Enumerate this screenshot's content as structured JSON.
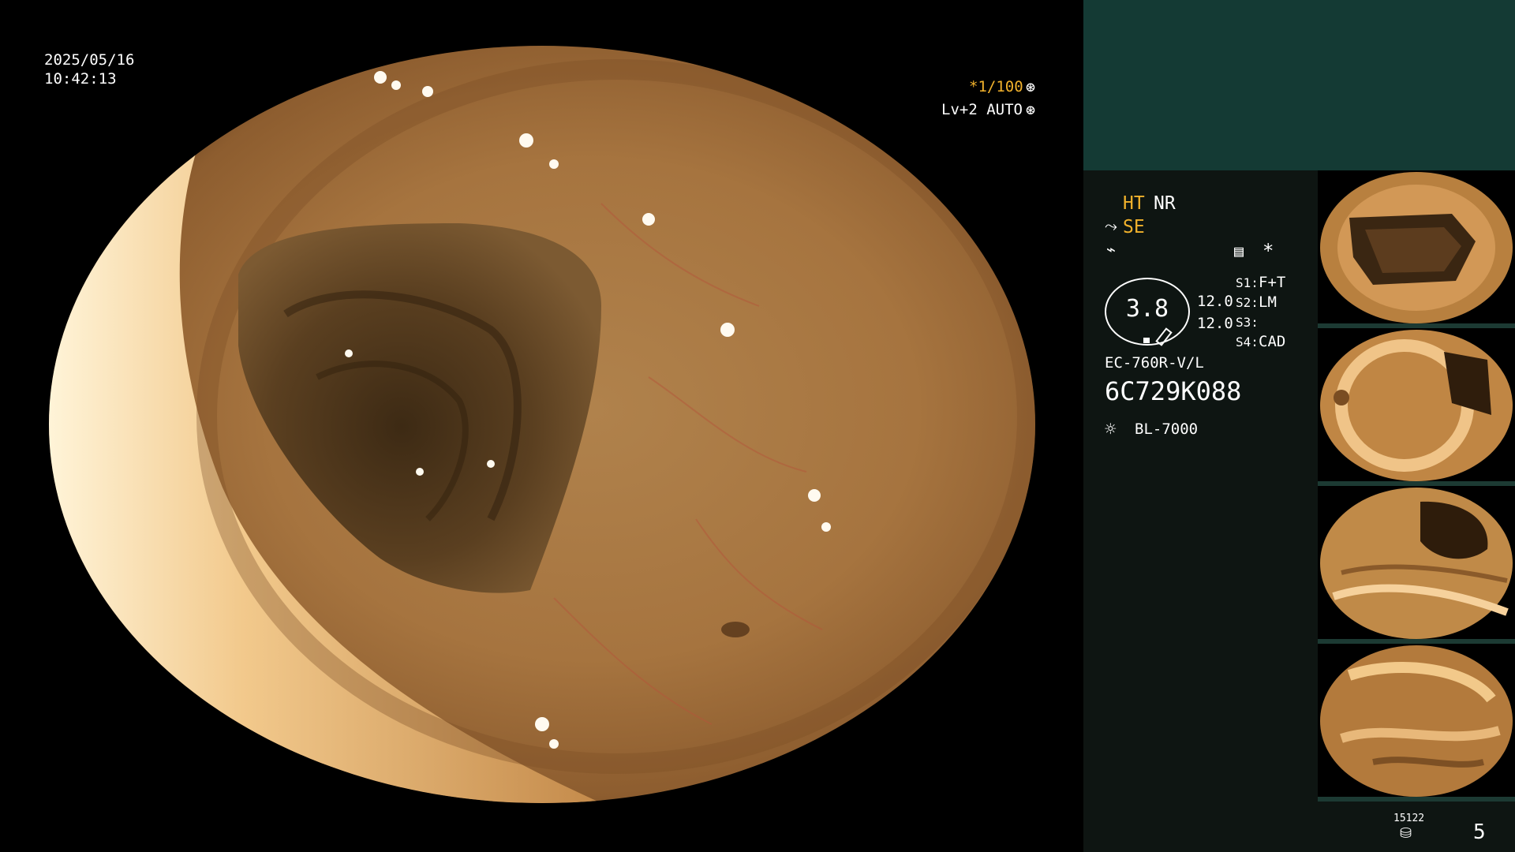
{
  "overlay": {
    "date": "2025/05/16",
    "time": "10:42:13",
    "shutter": "*1/100",
    "shutter_icon": "aperture-icon",
    "level": "Lv+2 AUTO",
    "level_icon": "aperture-icon"
  },
  "panel": {
    "ht": "HT",
    "nr": "NR",
    "se": "SE",
    "se_icon": "enhance-icon",
    "flash_icon": "lightning-icon",
    "menu_icon": "picture-mode-icon",
    "star": "*",
    "zoom": "3.8",
    "zoom_scale_top": "12.0",
    "zoom_scale_bottom": "12.0",
    "s1_label": "S1:",
    "s1_value": "F+T",
    "s2_label": "S2:",
    "s2_value": "LM",
    "s3_label": "S3:",
    "s3_value": "",
    "s4_label": "S4:",
    "s4_value": "CAD",
    "scope_model": "EC-760R-V/L",
    "serial": "6C729K088",
    "light_icon": "light-source-icon",
    "light_source": "BL-7000",
    "storage_label": "15122",
    "storage_icon": "storage-disk-icon",
    "capture_count": "5"
  },
  "colors": {
    "accent_amber": "#f2b22c",
    "panel_bg": "#0e1512",
    "panel_top_bg": "#143a34"
  }
}
